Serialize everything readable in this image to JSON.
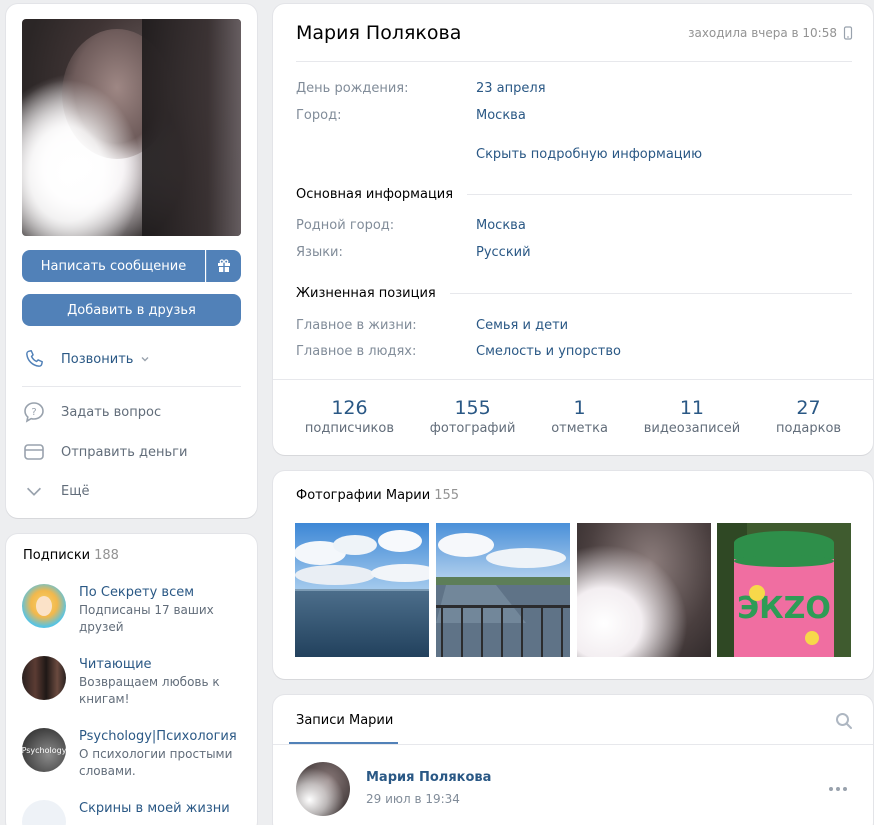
{
  "profile": {
    "name": "Мария Полякова",
    "last_seen": "заходила вчера в 10:58"
  },
  "actions": {
    "write_message": "Написать сообщение",
    "add_friend": "Добавить в друзья",
    "call": "Позвонить",
    "ask_question": "Задать вопрос",
    "send_money": "Отправить деньги",
    "more": "Ещё"
  },
  "info": {
    "birthday_label": "День рождения:",
    "birthday_value": "23 апреля",
    "city_label": "Город:",
    "city_value": "Москва",
    "hide_details": "Скрыть подробную информацию",
    "section_main": "Основная информация",
    "hometown_label": "Родной город:",
    "hometown_value": "Москва",
    "languages_label": "Языки:",
    "languages_value": "Русский",
    "section_life": "Жизненная позиция",
    "life_main_label": "Главное в жизни:",
    "life_main_value": "Семья и дети",
    "people_main_label": "Главное в людях:",
    "people_main_value": "Смелость и упорство"
  },
  "counters": [
    {
      "num": "126",
      "label": "подписчиков"
    },
    {
      "num": "155",
      "label": "фотографий"
    },
    {
      "num": "1",
      "label": "отметка"
    },
    {
      "num": "11",
      "label": "видеозаписей"
    },
    {
      "num": "27",
      "label": "подарков"
    }
  ],
  "photos": {
    "title": "Фотографии Марии",
    "count": "155"
  },
  "subscriptions": {
    "title": "Подписки",
    "count": "188",
    "items": [
      {
        "name": "По Секрету всем",
        "desc": "Подписаны 17 ваших друзей"
      },
      {
        "name": "Читающие",
        "desc": "Возвращаем любовь к книгам!"
      },
      {
        "name": "Psychology|Психология",
        "desc": "О психологии простыми словами.",
        "avatar_text": "Psychology"
      },
      {
        "name": "Скрины в моей жизни",
        "desc": ""
      }
    ]
  },
  "posts": {
    "tab": "Записи Марии",
    "author": "Мария Полякова",
    "date": "29 июл в 19:34"
  },
  "colors": {
    "accent": "#5181b8",
    "link": "#2a5885",
    "background": "#edeef0"
  }
}
